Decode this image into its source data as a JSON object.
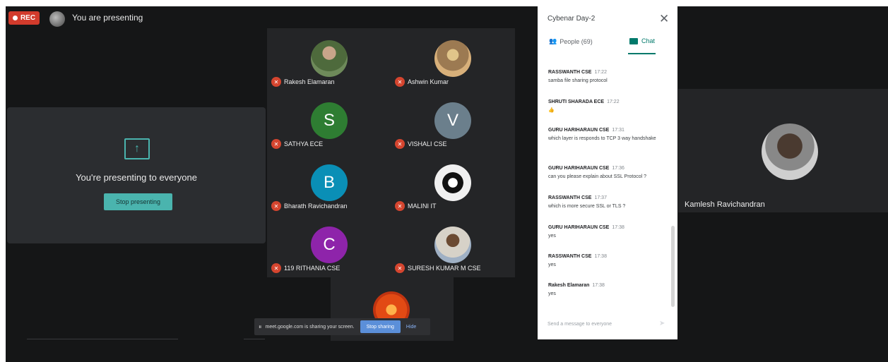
{
  "topbar": {
    "rec_label": "REC",
    "presenting_label": "You are presenting"
  },
  "presenting_card": {
    "icon": "present-to-all-icon",
    "message": "You're presenting to everyone",
    "stop_button": "Stop presenting"
  },
  "participants": [
    {
      "name": "Rakesh Elamaran",
      "avatar": "photo",
      "muted": true
    },
    {
      "name": "Ashwin Kumar",
      "avatar": "photo",
      "muted": true
    },
    {
      "name": "SATHYA ECE",
      "initial": "S",
      "color": "#2e7d32",
      "muted": true
    },
    {
      "name": "VISHALI CSE",
      "initial": "V",
      "color": "#6b7f8c",
      "muted": true
    },
    {
      "name": "Bharath Ravichandran",
      "initial": "B",
      "color": "#0a8fb6",
      "muted": true
    },
    {
      "name": "MALINI IT",
      "avatar": "photo",
      "muted": true
    },
    {
      "name": "119 RITHANIA CSE",
      "initial": "C",
      "color": "#8e24aa",
      "muted": true
    },
    {
      "name": "SURESH KUMAR M CSE",
      "avatar": "photo",
      "muted": true
    }
  ],
  "share_bar": {
    "text": "meet.google.com is sharing your screen.",
    "stop_button": "Stop sharing",
    "hide_button": "Hide"
  },
  "chat_panel": {
    "title": "Cybenar Day-2",
    "tabs": {
      "people": "People (69)",
      "chat": "Chat"
    },
    "messages": [
      {
        "sender": "RASSWANTH CSE",
        "time": "17:22",
        "text": "samba file sharing protocol"
      },
      {
        "sender": "SHRUTI SHARADA ECE",
        "time": "17:22",
        "text": "👍"
      },
      {
        "sender": "GURU HARIHARAUN CSE",
        "time": "17:31",
        "text": "which layer is responds to TCP 3 way handshake"
      },
      {
        "sender": "GURU HARIHARAUN CSE",
        "time": "17:36",
        "text": "can you please explain about SSL Protocol ?"
      },
      {
        "sender": "RASSWANTH CSE",
        "time": "17:37",
        "text": "which is more secure SSL or TLS ?"
      },
      {
        "sender": "GURU HARIHARAUN CSE",
        "time": "17:38",
        "text": "yes"
      },
      {
        "sender": "RASSWANTH CSE",
        "time": "17:38",
        "text": "yes"
      },
      {
        "sender": "Rakesh Elamaran",
        "time": "17:38",
        "text": "yes"
      }
    ],
    "input_placeholder": "Send a message to everyone"
  },
  "right_tile": {
    "name": "Kamlesh Ravichandran"
  }
}
